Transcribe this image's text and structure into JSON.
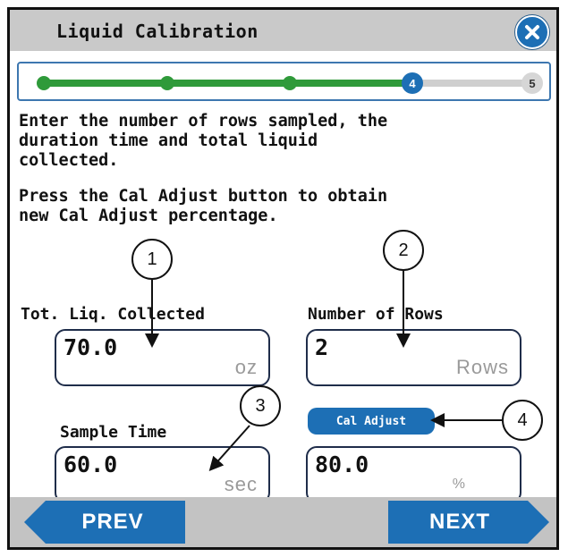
{
  "window": {
    "title": "Liquid Calibration",
    "close_icon": "close-icon"
  },
  "progress": {
    "steps": [
      "",
      "",
      "",
      "4",
      "5"
    ],
    "current_step": 4,
    "total_steps": 5
  },
  "instructions": {
    "line1": "Enter the number of rows sampled, the\nduration time and total liquid\ncollected.",
    "line2": "Press the Cal Adjust button to obtain\nnew Cal Adjust percentage."
  },
  "fields": {
    "liquid": {
      "label": "Tot. Liq. Collected",
      "value": "70.0",
      "unit": "oz"
    },
    "rows": {
      "label": "Number of Rows",
      "value": "2",
      "unit": "Rows"
    },
    "sample_time": {
      "label": "Sample Time",
      "value": "60.0",
      "unit": "sec"
    },
    "cal_adjust": {
      "button": "Cal Adjust",
      "value": "80.0",
      "unit": "%"
    }
  },
  "callouts": [
    "1",
    "2",
    "3",
    "4"
  ],
  "nav": {
    "prev": "PREV",
    "next": "NEXT"
  },
  "colors": {
    "accent": "#1d6fb5",
    "progress": "#2f9a3a",
    "bar": "#c9c9c9"
  }
}
